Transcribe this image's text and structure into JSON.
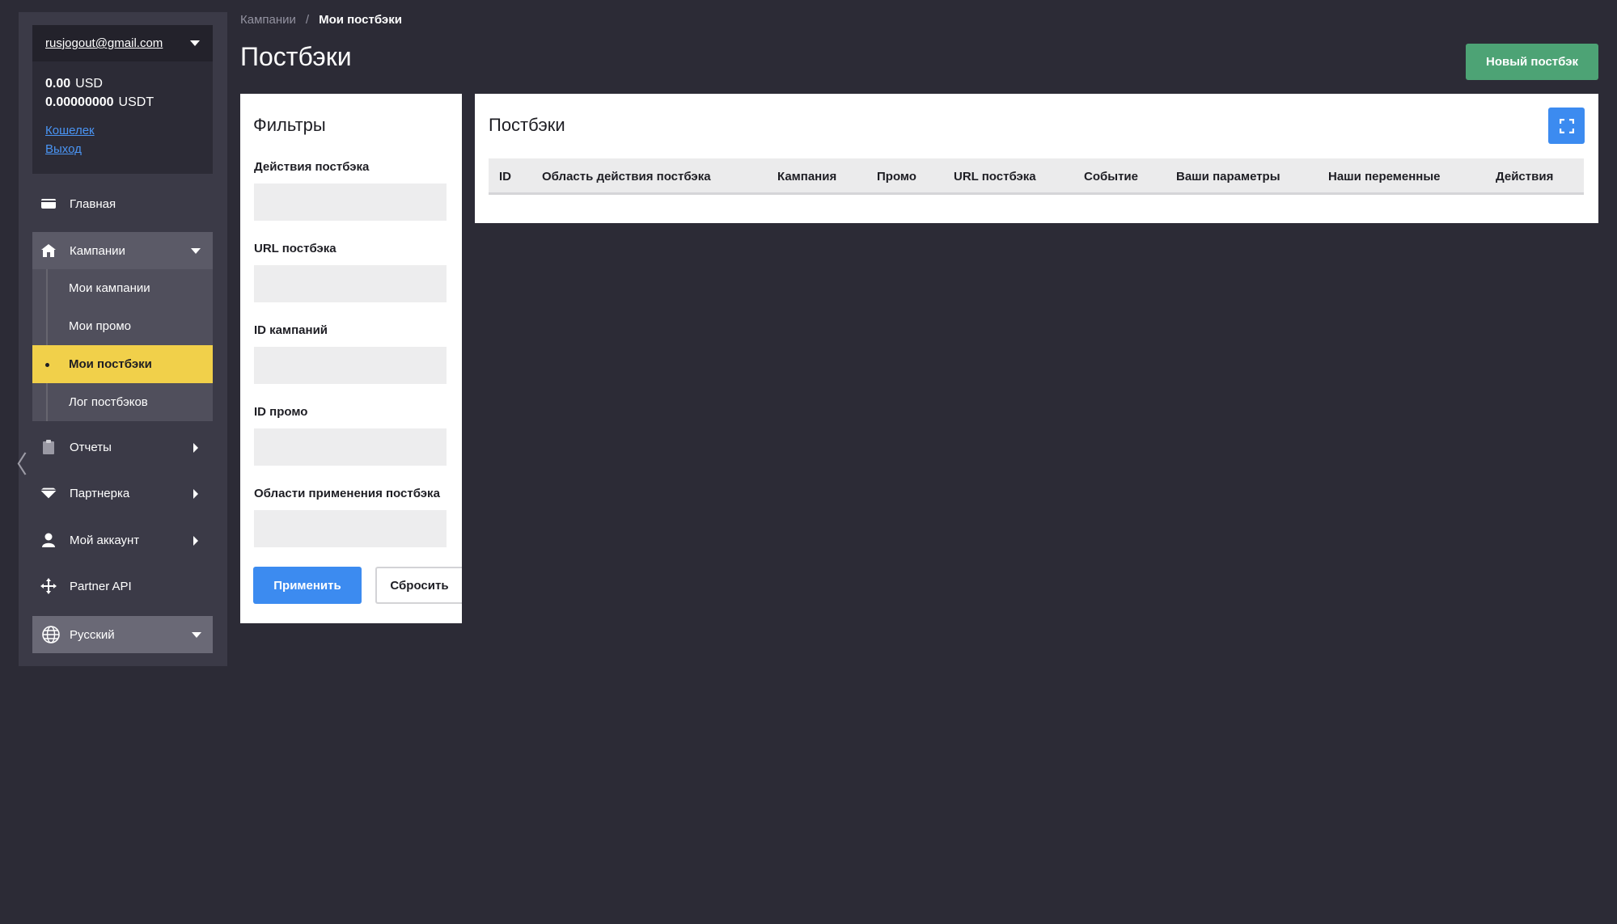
{
  "account": {
    "email": "rusjogout@gmail.com",
    "balances": [
      {
        "amount": "0.00",
        "currency": "USD"
      },
      {
        "amount": "0.00000000",
        "currency": "USDT"
      }
    ],
    "links": {
      "wallet": "Кошелек",
      "logout": "Выход"
    }
  },
  "nav": {
    "home": "Главная",
    "campaigns": "Кампании",
    "campaigns_sub": {
      "my_campaigns": "Мои кампании",
      "my_promos": "Мои промо",
      "my_postbacks": "Мои постбэки",
      "postback_log": "Лог постбэков"
    },
    "reports": "Отчеты",
    "partner": "Партнерка",
    "my_account": "Мой аккаунт",
    "partner_api": "Partner API",
    "language": "Русский",
    "collapse_glyph": "〈"
  },
  "breadcrumb": {
    "parent": "Кампании",
    "separator": "/",
    "current": "Мои постбэки"
  },
  "page_title": "Постбэки",
  "new_button": "Новый постбэк",
  "filters": {
    "title": "Фильтры",
    "fields": {
      "actions": {
        "label": "Действия постбэка",
        "value": ""
      },
      "url": {
        "label": "URL постбэка",
        "value": ""
      },
      "campaign_ids": {
        "label": "ID кампаний",
        "value": ""
      },
      "promo_ids": {
        "label": "ID промо",
        "value": ""
      },
      "scopes": {
        "label": "Области применения постбэка",
        "value": ""
      }
    },
    "apply": "Применить",
    "reset": "Сбросить"
  },
  "table": {
    "title": "Постбэки",
    "columns": {
      "id": "ID",
      "scope": "Область действия постбэка",
      "campaign": "Кампания",
      "promo": "Промо",
      "url": "URL постбэка",
      "event": "Событие",
      "your_params": "Ваши параметры",
      "our_vars": "Наши переменные",
      "actions": "Действия"
    },
    "rows": []
  },
  "colors": {
    "background": "#2c2b36",
    "sidebar": "#3b3a47",
    "active_item": "#f1d04a",
    "primary": "#3c8bf0",
    "success": "#4da375"
  },
  "icons": {
    "home": "card-icon",
    "campaigns": "house-icon",
    "reports": "clipboard-icon",
    "partner": "diamond-icon",
    "account": "person-icon",
    "api": "move-arrows-icon",
    "language": "globe-icon",
    "fullscreen": "expand-icon"
  }
}
